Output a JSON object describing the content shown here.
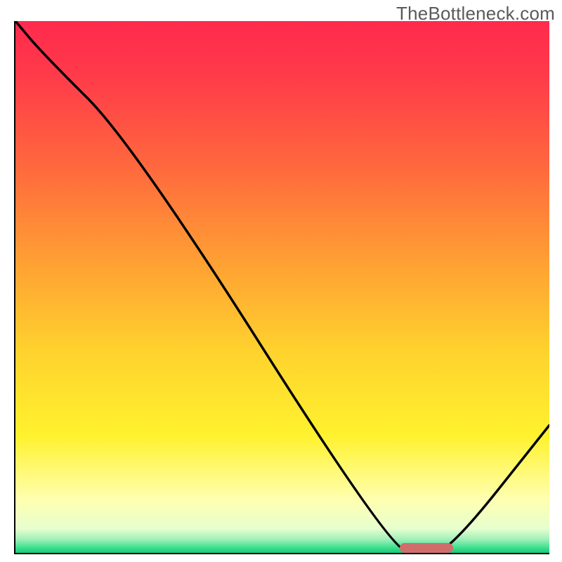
{
  "watermark": "TheBottleneck.com",
  "chart_data": {
    "type": "line",
    "title": "",
    "xlabel": "",
    "ylabel": "",
    "xlim": [
      0,
      100
    ],
    "ylim": [
      0,
      100
    ],
    "grid": false,
    "x": [
      0,
      5,
      22,
      70,
      76,
      81,
      100
    ],
    "y": [
      100,
      94,
      77,
      1,
      0,
      0,
      24
    ],
    "optimal_marker": {
      "x_start": 72,
      "x_end": 82,
      "y": 0,
      "color": "#cf6d6d"
    },
    "background_gradient_stops": [
      {
        "pos": 0.0,
        "color": "#ff2a4d"
      },
      {
        "pos": 0.1,
        "color": "#ff3a4a"
      },
      {
        "pos": 0.28,
        "color": "#ff6a3d"
      },
      {
        "pos": 0.46,
        "color": "#ffa233"
      },
      {
        "pos": 0.62,
        "color": "#ffd22e"
      },
      {
        "pos": 0.78,
        "color": "#fff22e"
      },
      {
        "pos": 0.9,
        "color": "#ffffb0"
      },
      {
        "pos": 0.955,
        "color": "#e6ffcf"
      },
      {
        "pos": 0.975,
        "color": "#9ff0b8"
      },
      {
        "pos": 0.99,
        "color": "#3de08e"
      },
      {
        "pos": 1.0,
        "color": "#17c87a"
      }
    ]
  },
  "plot": {
    "inner_w": 760,
    "inner_h": 757
  }
}
